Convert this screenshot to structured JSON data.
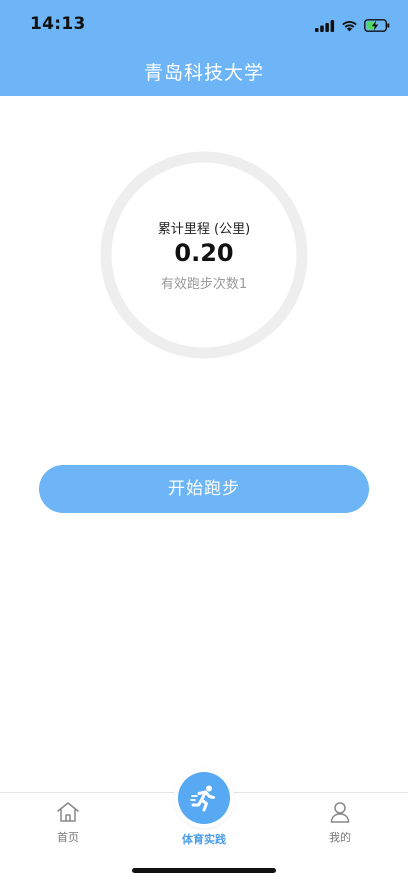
{
  "status_bar": {
    "time": "14:13"
  },
  "header": {
    "title": "青岛科技大学"
  },
  "stats": {
    "label": "累计里程 (公里)",
    "distance": "0.20",
    "valid_runs": "有效跑步次数1"
  },
  "actions": {
    "start_run_label": "开始跑步"
  },
  "tabbar": {
    "items": [
      {
        "label": "首页",
        "icon": "home-icon",
        "active": false
      },
      {
        "label": "体育实践",
        "icon": "runner-icon",
        "active": true
      },
      {
        "label": "我的",
        "icon": "user-icon",
        "active": false
      }
    ]
  },
  "colors": {
    "primary": "#6db5f6",
    "active_tab": "#4a9ee9",
    "ring": "#eeeeee"
  }
}
